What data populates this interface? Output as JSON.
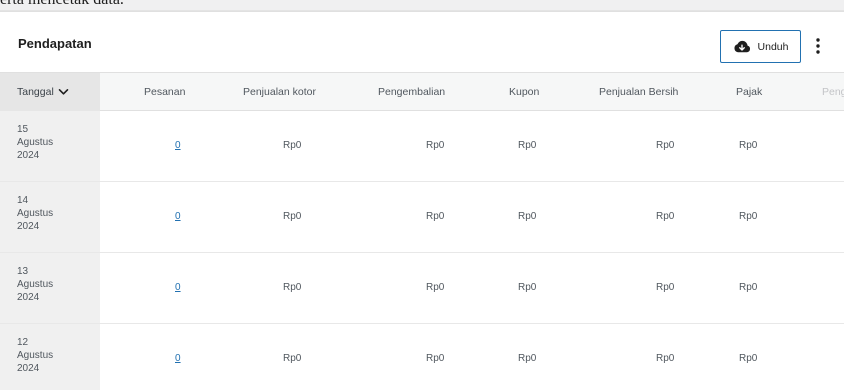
{
  "top_fragment": "erta mencetak data.",
  "panel": {
    "title": "Pendapatan",
    "download_label": "Unduh"
  },
  "columns": {
    "date": "Tanggal",
    "orders": "Pesanan",
    "gross_sales": "Penjualan kotor",
    "returns": "Pengembalian",
    "coupons": "Kupon",
    "net_sales": "Penjualan Bersih",
    "taxes": "Pajak",
    "partial": "Peng"
  },
  "rows": [
    {
      "day": "15",
      "month": "Agustus",
      "year": "2024",
      "orders": "0",
      "gross_sales": "Rp0",
      "returns": "Rp0",
      "coupons": "Rp0",
      "net_sales": "Rp0",
      "taxes": "Rp0"
    },
    {
      "day": "14",
      "month": "Agustus",
      "year": "2024",
      "orders": "0",
      "gross_sales": "Rp0",
      "returns": "Rp0",
      "coupons": "Rp0",
      "net_sales": "Rp0",
      "taxes": "Rp0"
    },
    {
      "day": "13",
      "month": "Agustus",
      "year": "2024",
      "orders": "0",
      "gross_sales": "Rp0",
      "returns": "Rp0",
      "coupons": "Rp0",
      "net_sales": "Rp0",
      "taxes": "Rp0"
    },
    {
      "day": "12",
      "month": "Agustus",
      "year": "2024",
      "orders": "0",
      "gross_sales": "Rp0",
      "returns": "Rp0",
      "coupons": "Rp0",
      "net_sales": "Rp0",
      "taxes": "Rp0"
    }
  ],
  "icons": {
    "download": "cloud-download-icon",
    "more": "more-vertical-icon",
    "sort": "chevron-down-icon"
  },
  "colors": {
    "accent": "#2271b1",
    "date_column_bg": "#f0f0f0"
  }
}
